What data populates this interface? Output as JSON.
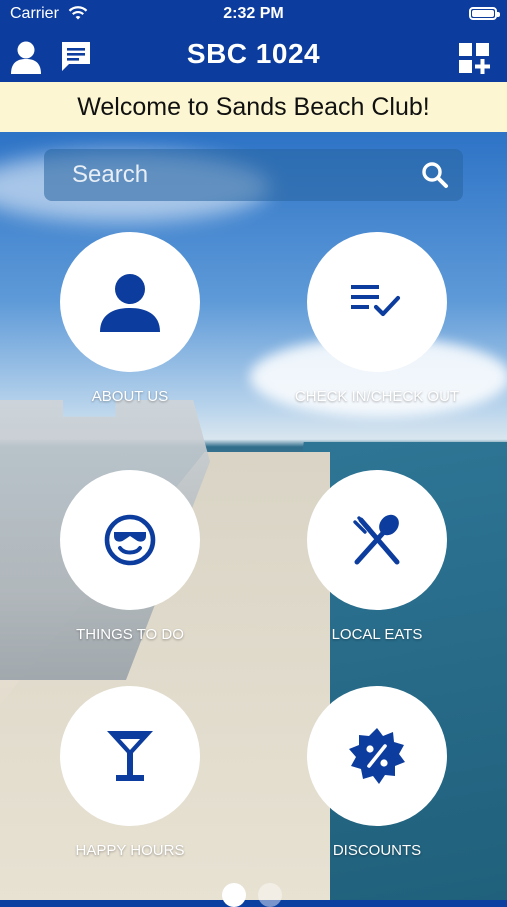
{
  "status": {
    "carrier": "Carrier",
    "time": "2:32 PM"
  },
  "header": {
    "title": "SBC 1024"
  },
  "banner": {
    "text": "Welcome to Sands Beach Club!"
  },
  "search": {
    "placeholder": "Search"
  },
  "tiles": [
    {
      "label": "ABOUT US",
      "icon": "person-icon"
    },
    {
      "label": "CHECK IN/CHECK OUT",
      "icon": "checklist-icon"
    },
    {
      "label": "THINGS TO DO",
      "icon": "sunglasses-face-icon"
    },
    {
      "label": "LOCAL EATS",
      "icon": "fork-spoon-icon"
    },
    {
      "label": "HAPPY HOURS",
      "icon": "cocktail-icon"
    },
    {
      "label": "DISCOUNTS",
      "icon": "discount-badge-icon"
    }
  ],
  "colors": {
    "brand": "#0c3d9e",
    "banner_bg": "#fcf7d2",
    "tile_bg": "#ffffff"
  },
  "pager": {
    "current_page": 1
  }
}
